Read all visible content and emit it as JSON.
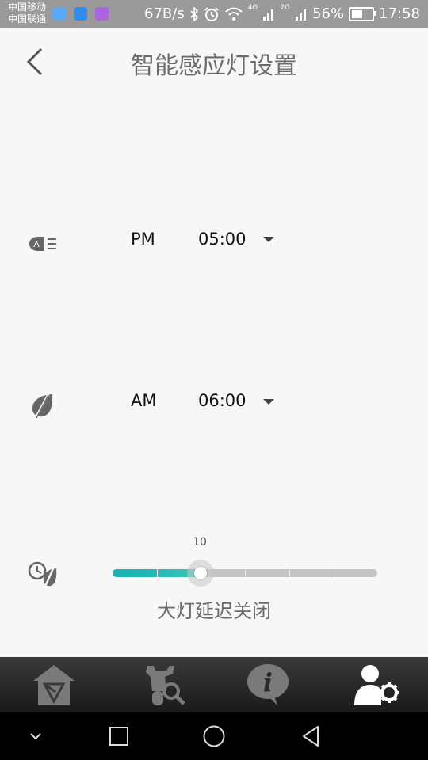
{
  "status_bar": {
    "carrier_1": "中国移动",
    "carrier_2": "中国联通",
    "net_speed": "67B/s",
    "signal_1": "4G",
    "signal_2": "2G",
    "battery_percent": "56%",
    "battery_level": 0.56,
    "time": "17:58"
  },
  "header": {
    "title": "智能感应灯设置"
  },
  "light_on": {
    "icon": "auto-headlight-icon",
    "period": "PM",
    "time": "05:00"
  },
  "light_off": {
    "icon": "light-off-icon",
    "period": "AM",
    "time": "06:00"
  },
  "delay": {
    "icon": "timer-light-icon",
    "value": "10",
    "fraction": 0.33,
    "label": "大灯延迟关闭"
  },
  "colors": {
    "accent": "#19aeb4",
    "track": "#c4c4c4",
    "tabbar": "#2a2a2a"
  },
  "tabs": [
    {
      "icon": "home-shield-icon",
      "active": false
    },
    {
      "icon": "scooter-search-icon",
      "active": false
    },
    {
      "icon": "info-bubble-icon",
      "active": false
    },
    {
      "icon": "user-settings-icon",
      "active": true
    }
  ],
  "nav": [
    "chevron-down-icon",
    "square-icon",
    "circle-icon",
    "triangle-back-icon"
  ]
}
